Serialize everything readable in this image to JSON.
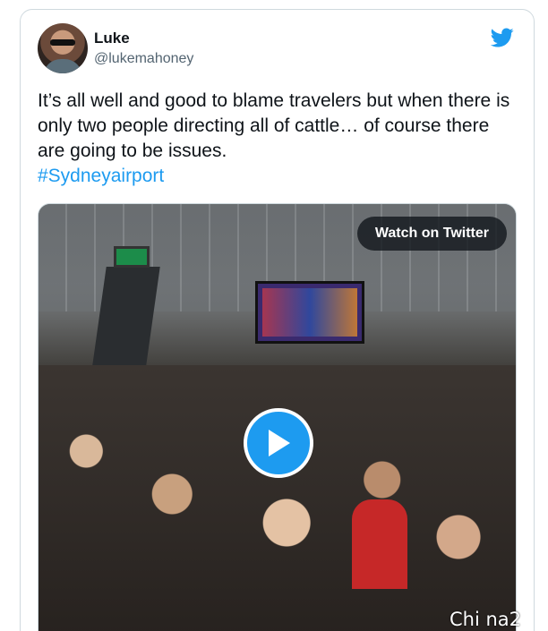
{
  "tweet": {
    "author_name": "Luke",
    "author_handle": "@lukemahoney",
    "text": "It’s all well and good to blame travelers but when there is only two people directing all of cattle… of course there are going to be issues.",
    "hashtag": "#Sydneyairport"
  },
  "media": {
    "watch_label": "Watch on Twitter",
    "play_icon": "play-icon"
  },
  "icons": {
    "brand": "twitter-bird-icon"
  },
  "colors": {
    "brand_blue": "#1d9bf0",
    "text_primary": "#0f1419",
    "text_secondary": "#536471",
    "border": "#cfd9de"
  },
  "watermark": {
    "text": "Chi na2"
  }
}
